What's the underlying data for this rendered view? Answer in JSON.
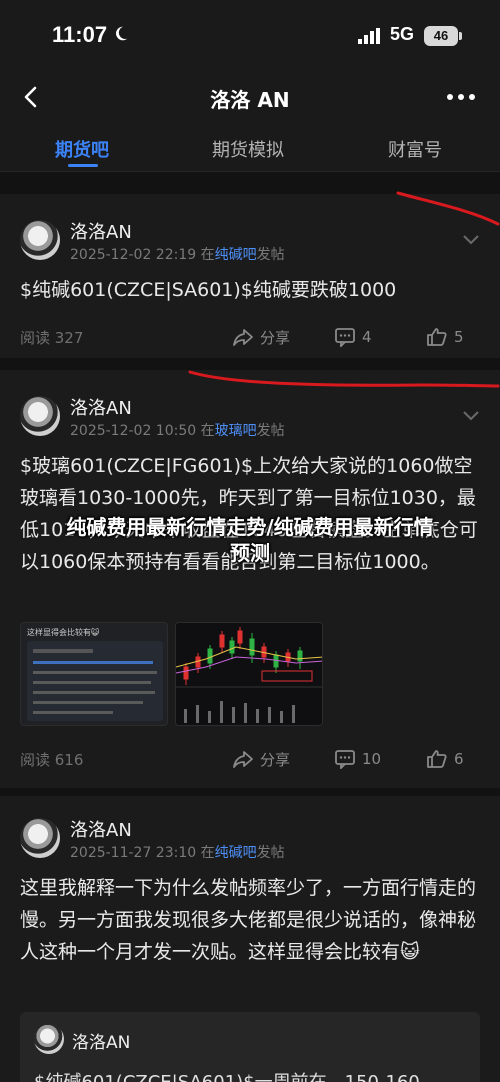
{
  "status": {
    "time": "11:07",
    "network": "5G",
    "battery": "46"
  },
  "nav": {
    "title": "洛洛 AN"
  },
  "tabs": [
    {
      "label": "期货吧",
      "active": true
    },
    {
      "label": "期货模拟",
      "active": false
    },
    {
      "label": "财富号",
      "active": false
    }
  ],
  "posts": [
    {
      "author": "洛洛AN",
      "datetime": "2025-12-02 22:19",
      "in_label": "在",
      "board": "纯碱吧",
      "posted_label": "发帖",
      "text": "$纯碱601(CZCE|SA601)$纯碱要跌破1000",
      "reads": "阅读 327",
      "share": "分享",
      "comments": "4",
      "likes": "5"
    },
    {
      "author": "洛洛AN",
      "datetime": "2025-12-02 10:50",
      "in_label": "在",
      "board": "玻璃吧",
      "posted_label": "发帖",
      "text": "$玻璃601(CZCE|FG601)$上次给大家说的1060做空玻璃看1030-1000先，昨天到了第一目标位1030，最低1017，今天中午收盘在1040左右横盘。空单底仓可以1060保本预持有看看能否到第二目标位1000。",
      "image_caption": "这样显得会比较有😺",
      "reads": "阅读 616",
      "share": "分享",
      "comments": "10",
      "likes": "6"
    },
    {
      "author": "洛洛AN",
      "datetime": "2025-11-27 23:10",
      "in_label": "在",
      "board": "纯碱吧",
      "posted_label": "发帖",
      "text": "这里我解释一下为什么发帖频率少了，一方面行情走的慢。另一方面我发现很多大佬都是很少说话的，像神秘人这种一个月才发一次贴。这样显得会比较有😺",
      "quote_author": "洛洛AN",
      "quote_text": "$纯碱601(CZCE|SA601)$一周前在，150-160"
    }
  ],
  "overlay": {
    "title": "纯碱费用最新行情走势/纯碱费用最新行情预测"
  },
  "colors": {
    "accent": "#3b82f6",
    "link": "#4e8ff7",
    "annotation": "#d8191e",
    "background": "#121212",
    "card": "#1b1b1b"
  }
}
